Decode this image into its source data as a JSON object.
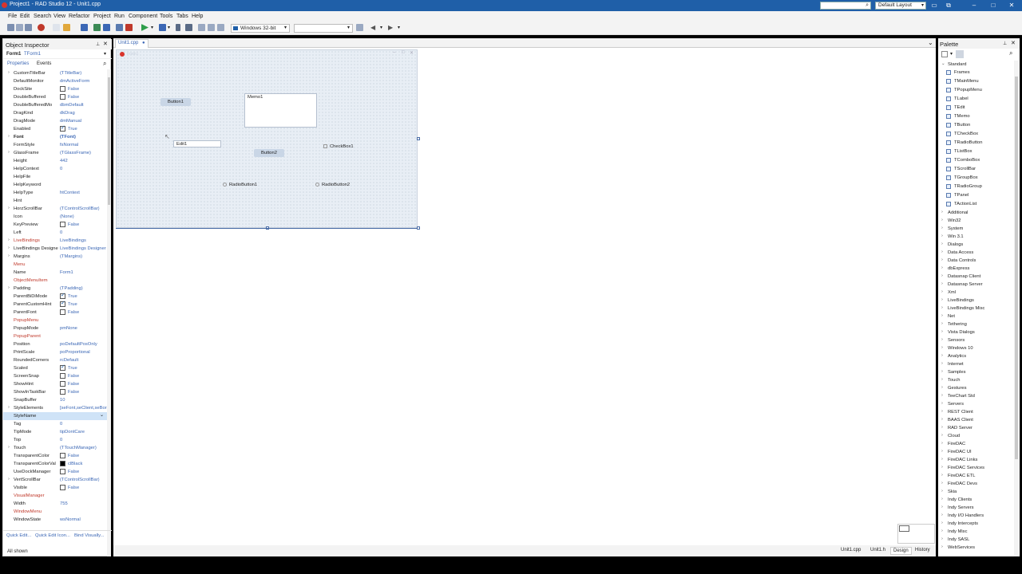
{
  "titlebar": {
    "title": "Project1 - RAD Studio 12 - Unit1.cpp",
    "search_placeholder": "",
    "layout": "Default Layout",
    "controls": [
      "minimize-icon",
      "maximize-icon",
      "close-icon"
    ]
  },
  "menubar": [
    "File",
    "Edit",
    "Search",
    "View",
    "Refactor",
    "Project",
    "Run",
    "Component",
    "Tools",
    "Tabs",
    "Help"
  ],
  "toolbar": {
    "platform": "Windows 32-bit",
    "configuration": ""
  },
  "object_inspector": {
    "title": "Object Inspector",
    "component_name": "Form1",
    "component_type": "TForm1",
    "tabs": [
      "Properties",
      "Events"
    ],
    "properties": [
      {
        "name": "CustomTitleBar",
        "value": "(TTitleBar)",
        "expand": true
      },
      {
        "name": "DefaultMonitor",
        "value": "dmActiveForm"
      },
      {
        "name": "DockSite",
        "value": "False",
        "check": false
      },
      {
        "name": "DoubleBuffered",
        "value": "False",
        "check": false
      },
      {
        "name": "DoubleBufferedMo",
        "value": "dbmDefault"
      },
      {
        "name": "DragKind",
        "value": "dkDrag"
      },
      {
        "name": "DragMode",
        "value": "dmManual"
      },
      {
        "name": "Enabled",
        "value": "True",
        "check": true
      },
      {
        "name": "Font",
        "value": "(TFont)",
        "expand": true,
        "bold": true
      },
      {
        "name": "FormStyle",
        "value": "fsNormal"
      },
      {
        "name": "GlassFrame",
        "value": "(TGlassFrame)",
        "expand": true
      },
      {
        "name": "Height",
        "value": "442"
      },
      {
        "name": "HelpContext",
        "value": "0"
      },
      {
        "name": "HelpFile",
        "value": ""
      },
      {
        "name": "HelpKeyword",
        "value": ""
      },
      {
        "name": "HelpType",
        "value": "htContext"
      },
      {
        "name": "Hint",
        "value": ""
      },
      {
        "name": "HorzScrollBar",
        "value": "(TControlScrollBar)",
        "expand": true
      },
      {
        "name": "Icon",
        "value": "(None)"
      },
      {
        "name": "KeyPreview",
        "value": "False",
        "check": false
      },
      {
        "name": "Left",
        "value": "0"
      },
      {
        "name": "LiveBindings",
        "value": "LiveBindings",
        "expand": true,
        "red": true
      },
      {
        "name": "LiveBindings Designe",
        "value": "LiveBindings Designer",
        "expand": true
      },
      {
        "name": "Margins",
        "value": "(TMargins)",
        "expand": true
      },
      {
        "name": "Menu",
        "value": "",
        "red": true
      },
      {
        "name": "Name",
        "value": "Form1"
      },
      {
        "name": "ObjectMenuItem",
        "value": "",
        "red": true
      },
      {
        "name": "Padding",
        "value": "(TPadding)",
        "expand": true
      },
      {
        "name": "ParentBiDiMode",
        "value": "True",
        "check": true
      },
      {
        "name": "ParentCustomHint",
        "value": "True",
        "check": true
      },
      {
        "name": "ParentFont",
        "value": "False",
        "check": false
      },
      {
        "name": "PopupMenu",
        "value": "",
        "red": true
      },
      {
        "name": "PopupMode",
        "value": "pmNone"
      },
      {
        "name": "PopupParent",
        "value": "",
        "red": true
      },
      {
        "name": "Position",
        "value": "poDefaultPosOnly"
      },
      {
        "name": "PrintScale",
        "value": "poProportional"
      },
      {
        "name": "RoundedCorners",
        "value": "rcDefault"
      },
      {
        "name": "Scaled",
        "value": "True",
        "check": true
      },
      {
        "name": "ScreenSnap",
        "value": "False",
        "check": false
      },
      {
        "name": "ShowHint",
        "value": "False",
        "check": false
      },
      {
        "name": "ShowInTaskBar",
        "value": "False",
        "check": false
      },
      {
        "name": "SnapBuffer",
        "value": "10"
      },
      {
        "name": "StyleElements",
        "value": "[seFont,seClient,seBor",
        "expand": true
      },
      {
        "name": "StyleName",
        "value": "",
        "selected": true
      },
      {
        "name": "Tag",
        "value": "0"
      },
      {
        "name": "TipMode",
        "value": "tipDontCare"
      },
      {
        "name": "Top",
        "value": "0"
      },
      {
        "name": "Touch",
        "value": "(TTouchManager)",
        "expand": true
      },
      {
        "name": "TransparentColor",
        "value": "False",
        "check": false
      },
      {
        "name": "TransparentColorVal",
        "value": "clBlack",
        "swatch": "#000000"
      },
      {
        "name": "UseDockManager",
        "value": "False",
        "check": false
      },
      {
        "name": "VertScrollBar",
        "value": "(TControlScrollBar)",
        "expand": true
      },
      {
        "name": "Visible",
        "value": "False",
        "check": false
      },
      {
        "name": "VisualManager",
        "value": "",
        "red": true
      },
      {
        "name": "Width",
        "value": "755"
      },
      {
        "name": "WindowMenu",
        "value": "",
        "red": true
      },
      {
        "name": "WindowState",
        "value": "wsNormal"
      }
    ],
    "links": [
      "Quick Edit...",
      "Quick Edit Icon...",
      "Bind Visually..."
    ],
    "status": "All shown"
  },
  "editor": {
    "tab": "Unit1.cpp",
    "form_caption": "Form1",
    "components": {
      "button1": "Button1",
      "button2": "Button2",
      "memo1": "Memo1",
      "edit1": "Edit1",
      "checkbox1": "CheckBox1",
      "radio1": "RadioButton1",
      "radio2": "RadioButton2"
    },
    "bottom_tabs": [
      "Unit1.cpp",
      "Unit1.h",
      "Design",
      "History"
    ],
    "active_bottom_tab": "Design"
  },
  "palette": {
    "title": "Palette",
    "expanded_category": "Standard",
    "standard_items": [
      "Frames",
      "TMainMenu",
      "TPopupMenu",
      "TLabel",
      "TEdit",
      "TMemo",
      "TButton",
      "TCheckBox",
      "TRadioButton",
      "TListBox",
      "TComboBox",
      "TScrollBar",
      "TGroupBox",
      "TRadioGroup",
      "TPanel",
      "TActionList"
    ],
    "categories": [
      "Additional",
      "Win32",
      "System",
      "Win 3.1",
      "Dialogs",
      "Data Access",
      "Data Controls",
      "dbExpress",
      "Datasnap Client",
      "Datasnap Server",
      "Xml",
      "LiveBindings",
      "LiveBindings Misc",
      "Net",
      "Tethering",
      "Vista Dialogs",
      "Sensors",
      "Windows 10",
      "Analytics",
      "Internet",
      "Samples",
      "Touch",
      "Gestures",
      "TeeChart Std",
      "Servers",
      "REST Client",
      "BAAS Client",
      "RAD Server",
      "Cloud",
      "FireDAC",
      "FireDAC UI",
      "FireDAC Links",
      "FireDAC Services",
      "FireDAC ETL",
      "FireDAC Devs",
      "Skia",
      "Indy Clients",
      "Indy Servers",
      "Indy I/O Handlers",
      "Indy Intercepts",
      "Indy Misc",
      "Indy SASL",
      "WebServices"
    ]
  },
  "colors": {
    "titlebar": "#1f5fa8",
    "value_text": "#3b67b5",
    "red_prop": "#c0392b"
  }
}
